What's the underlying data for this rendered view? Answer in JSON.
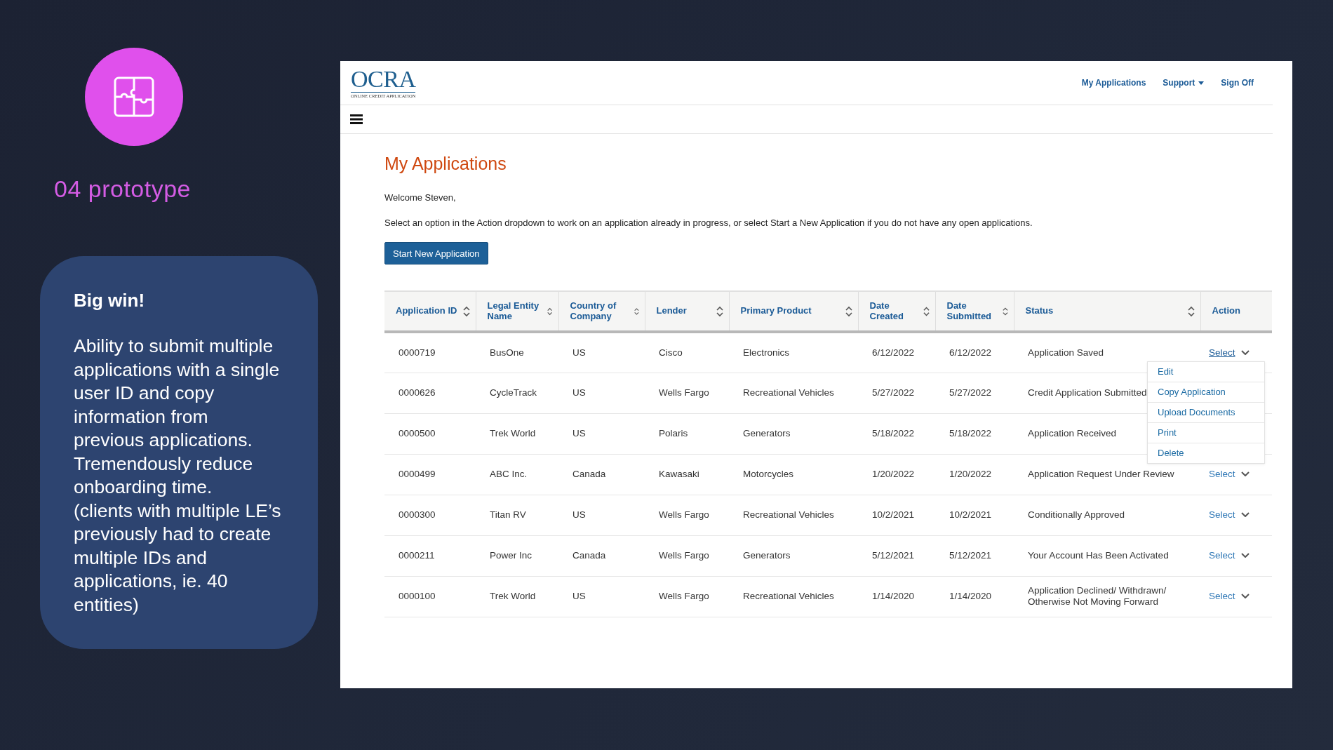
{
  "slide": {
    "section_title": "04 prototype",
    "card": {
      "heading": "Big win!",
      "paragraphs": [
        "Ability to submit multiple applications with a single user ID and copy information from previous applications.",
        "Tremendously reduce onboarding time.",
        "(clients with multiple LE’s previously had to create multiple IDs and applications, ie. 40 entities)"
      ]
    }
  },
  "app": {
    "logo": {
      "title": "OCRA",
      "subtitle": "ONLINE CREDIT APPLICATION"
    },
    "nav": [
      {
        "label": "My Applications",
        "dropdown": false
      },
      {
        "label": "Support",
        "dropdown": true
      },
      {
        "label": "Sign Off",
        "dropdown": false
      }
    ],
    "page_title": "My Applications",
    "welcome": "Welcome Steven,",
    "instructions": "Select an option in the Action dropdown to work on an application already in progress, or select Start a New Application if you do not have any open applications.",
    "primary_button": "Start New Application",
    "table": {
      "columns": [
        {
          "label": "Application ID",
          "sortable": true
        },
        {
          "label": "Legal Entity Name",
          "sortable": true
        },
        {
          "label": "Country of Company",
          "sortable": true
        },
        {
          "label": "Lender",
          "sortable": true
        },
        {
          "label": "Primary Product",
          "sortable": true
        },
        {
          "label": "Date Created",
          "sortable": true
        },
        {
          "label": "Date Submitted",
          "sortable": true
        },
        {
          "label": "Status",
          "sortable": true
        },
        {
          "label": "Action",
          "sortable": false
        }
      ],
      "rows": [
        {
          "cells": [
            "0000719",
            "BusOne",
            "US",
            "Cisco",
            "Electronics",
            "6/12/2022",
            "6/12/2022",
            "Application Saved"
          ],
          "action": {
            "label": "Select",
            "expanded": true,
            "menu": [
              "Edit",
              "Copy Application",
              "Upload Documents",
              "Print",
              "Delete"
            ]
          }
        },
        {
          "cells": [
            "0000626",
            "CycleTrack",
            "US",
            "Wells Fargo",
            "Recreational Vehicles",
            "5/27/2022",
            "5/27/2022",
            "Credit Application Submitted"
          ]
        },
        {
          "cells": [
            "0000500",
            "Trek World",
            "US",
            "Polaris",
            "Generators",
            "5/18/2022",
            "5/18/2022",
            "Application Received"
          ]
        },
        {
          "cells": [
            "0000499",
            "ABC Inc.",
            "Canada",
            "Kawasaki",
            "Motorcycles",
            "1/20/2022",
            "1/20/2022",
            "Application Request Under Review"
          ],
          "action": {
            "label": "Select",
            "expanded": false
          }
        },
        {
          "cells": [
            "0000300",
            "Titan RV",
            "US",
            "Wells Fargo",
            "Recreational Vehicles",
            "10/2/2021",
            "10/2/2021",
            "Conditionally Approved"
          ],
          "action": {
            "label": "Select",
            "expanded": false
          }
        },
        {
          "cells": [
            "0000211",
            "Power Inc",
            "Canada",
            "Wells Fargo",
            "Generators",
            "5/12/2021",
            "5/12/2021",
            "Your Account Has Been Activated"
          ],
          "action": {
            "label": "Select",
            "expanded": false
          }
        },
        {
          "cells": [
            "0000100",
            "Trek World",
            "US",
            "Wells Fargo",
            "Recreational Vehicles",
            "1/14/2020",
            "1/14/2020",
            "Application Declined/ Withdrawn/ Otherwise Not Moving Forward"
          ],
          "action": {
            "label": "Select",
            "expanded": false
          }
        }
      ]
    }
  }
}
